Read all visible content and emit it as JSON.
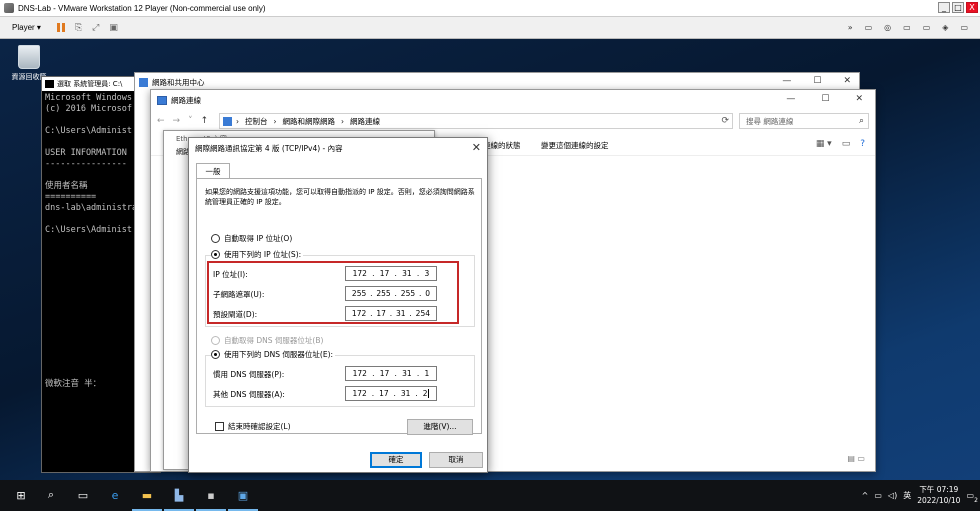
{
  "vmware": {
    "title": "DNS-Lab - VMware Workstation 12 Player (Non-commercial use only)",
    "menu_player": "Player",
    "controls": [
      "_",
      "□",
      "X"
    ]
  },
  "desktop": {
    "recycle_bin_label": "資源回收筒"
  },
  "cmd": {
    "title": "選取 系統管理員: C:\\",
    "lines": [
      "Microsoft Windows",
      "(c) 2016 Microsof",
      "",
      "C:\\Users\\Administ",
      "",
      "USER INFORMATION",
      "----------------",
      "",
      "使用者名稱",
      "==========",
      "dns-lab\\administra",
      "",
      "C:\\Users\\Administ",
      "",
      "",
      "",
      "",
      "",
      "",
      "",
      "",
      "",
      "",
      "",
      "",
      "",
      "微軟注音 半："
    ]
  },
  "network_center": {
    "title": "網路和共用中心"
  },
  "connections": {
    "title": "網路連線",
    "breadcrumb": [
      "控制台",
      "網路和網際網路",
      "網路連線"
    ],
    "search_placeholder": "搜尋 網路連線",
    "cmd_diagnose": "診斷這個連線的狀態",
    "cmd_change": "變更這個連線的設定"
  },
  "ethernet": {
    "title": "Ethernet0 內容",
    "tab": "網路"
  },
  "dialog": {
    "title": "網際網路通訊協定第 4 版 (TCP/IPv4) - 內容",
    "tab_general": "一般",
    "description": "如果您的網路支援這項功能，您可以取得自動指派的 IP 設定。否則，您必須詢問網路系統管理員正確的 IP 設定。",
    "radio_auto_ip": "自動取得 IP 位址(O)",
    "radio_manual_ip": "使用下列的 IP 位址(S):",
    "ip_label": "IP 位址(I):",
    "ip_value": [
      "172",
      "17",
      "31",
      "3"
    ],
    "subnet_label": "子網路遮罩(U):",
    "subnet_value": [
      "255",
      "255",
      "255",
      "0"
    ],
    "gateway_label": "預設閘道(D):",
    "gateway_value": [
      "172",
      "17",
      "31",
      "254"
    ],
    "radio_auto_dns": "自動取得 DNS 伺服器位址(B)",
    "radio_manual_dns": "使用下列的 DNS 伺服器位址(E):",
    "dns1_label": "慣用 DNS 伺服器(P):",
    "dns1_value": [
      "172",
      "17",
      "31",
      "1"
    ],
    "dns2_label": "其他 DNS 伺服器(A):",
    "dns2_value": [
      "172",
      "17",
      "31",
      "2"
    ],
    "validate_label": "結束時確認設定(L)",
    "advanced_button": "進階(V)...",
    "ok_button": "確定",
    "cancel_button": "取消"
  },
  "taskbar": {
    "ime": "英",
    "time": "下午 07:19",
    "date": "2022/10/10",
    "notification_count": "2"
  },
  "colors": {
    "highlight_box": "#c62828",
    "accent": "#0078d7"
  }
}
